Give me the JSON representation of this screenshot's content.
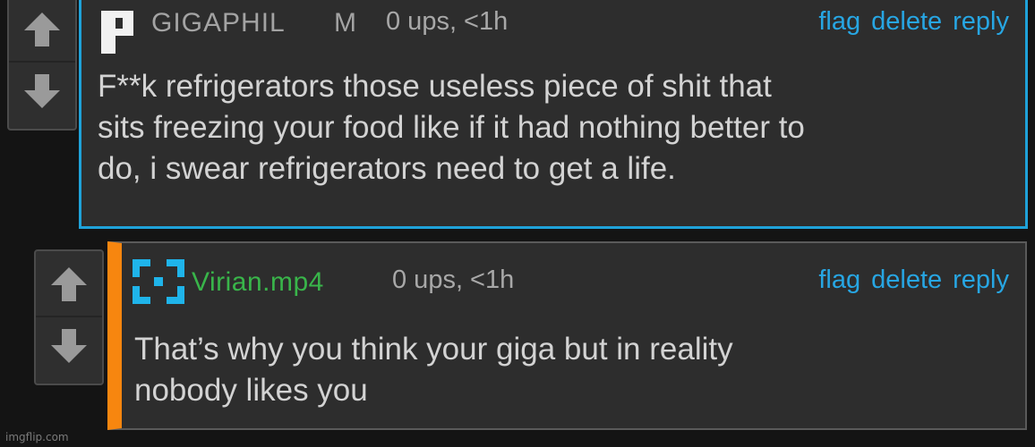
{
  "colors": {
    "background": "#141414",
    "comment_bg": "#2d2d2d",
    "highlight_border": "#1fa2d9",
    "reply_accent": "#f7860f",
    "link": "#27a6e3",
    "username_green": "#39b54a",
    "text": "#d3d3d3"
  },
  "comments": [
    {
      "avatar_icon": "p-letter-avatar-icon",
      "username": "GIGAPHIL",
      "gender": "M",
      "meta": "0 ups, <1h",
      "actions": {
        "flag": "flag",
        "delete": "delete",
        "reply": "reply"
      },
      "text": "F**k refrigerators those useless piece of shit that\nsits freezing your food like if it had nothing better to\ndo, i swear refrigerators need to get a life.",
      "upvote_icon": "arrow-up-icon",
      "downvote_icon": "arrow-down-icon"
    },
    {
      "avatar_icon": "pixel-frame-avatar-icon",
      "username": "Virian.mp4",
      "meta": "0 ups, <1h",
      "actions": {
        "flag": "flag",
        "delete": "delete",
        "reply": "reply"
      },
      "text": "That’s why you think your giga but in reality\nnobody likes you",
      "upvote_icon": "arrow-up-icon",
      "downvote_icon": "arrow-down-icon"
    }
  ],
  "watermark": "imgflip.com"
}
